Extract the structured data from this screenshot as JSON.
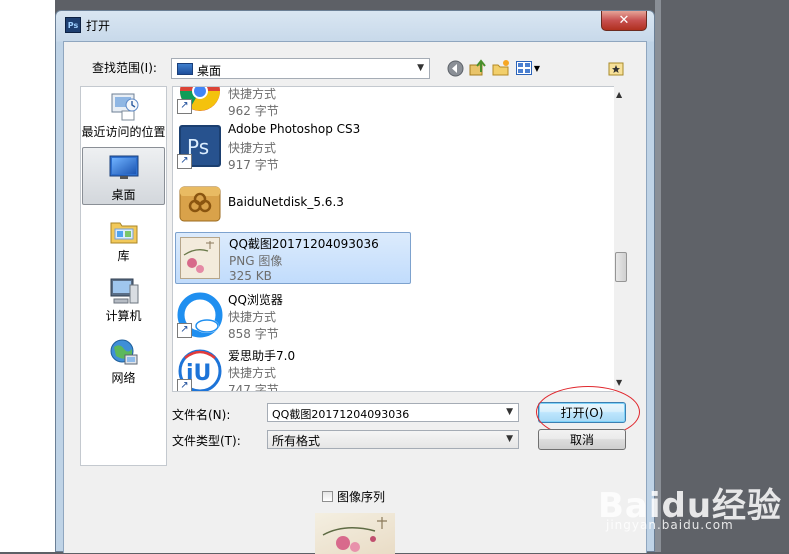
{
  "window": {
    "title": "打开",
    "app_icon_text": "Ps",
    "close_glyph": "✕"
  },
  "look_in": {
    "label": "查找范围(I):",
    "value": "桌面"
  },
  "places": [
    {
      "label": "最近访问的位置",
      "icon": "recent-places-icon"
    },
    {
      "label": "桌面",
      "icon": "desktop-icon",
      "active": true
    },
    {
      "label": "库",
      "icon": "libraries-icon"
    },
    {
      "label": "计算机",
      "icon": "computer-icon"
    },
    {
      "label": "网络",
      "icon": "network-icon"
    }
  ],
  "files": [
    {
      "name": "",
      "type": "快捷方式",
      "size": "962 字节",
      "icon": "chrome-icon"
    },
    {
      "name": "Adobe Photoshop CS3",
      "type": "快捷方式",
      "size": "917 字节",
      "icon": "photoshop-icon"
    },
    {
      "name": "BaiduNetdisk_5.6.3",
      "type": "",
      "size": "",
      "icon": "folder-box-icon"
    },
    {
      "name": "QQ截图20171204093036",
      "type": "PNG 图像",
      "size": "325 KB",
      "icon": "image-thumbnail-icon",
      "selected": true
    },
    {
      "name": "QQ浏览器",
      "type": "快捷方式",
      "size": "858 字节",
      "icon": "qq-browser-icon"
    },
    {
      "name": "爱思助手7.0",
      "type": "快捷方式",
      "size": "747 字节",
      "icon": "i4-assistant-icon"
    }
  ],
  "filename": {
    "label": "文件名(N):",
    "value": "QQ截图20171204093036"
  },
  "filetype": {
    "label": "文件类型(T):",
    "value": "所有格式"
  },
  "buttons": {
    "open": "打开(O)",
    "cancel": "取消"
  },
  "image_sequence": {
    "label": "图像序列",
    "checked": false
  },
  "watermark": {
    "main": "Baidu经验",
    "sub": "jingyan.baidu.com"
  },
  "colors": {
    "annotation": "#e0282e",
    "selection": "#c1dcfc"
  }
}
